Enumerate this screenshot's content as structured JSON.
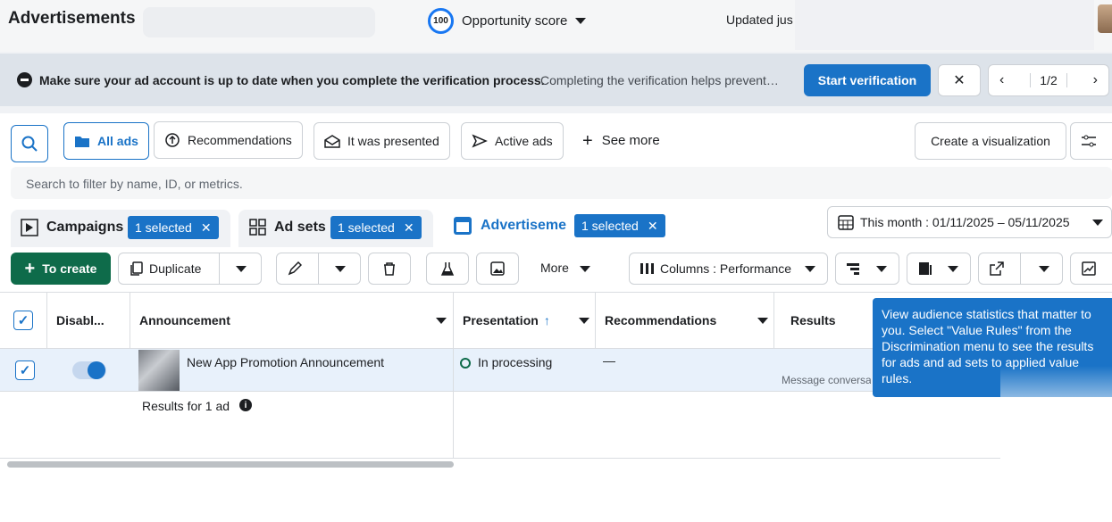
{
  "header": {
    "title": "Advertisements",
    "score_value": "100",
    "score_label": "Opportunity score",
    "updated": "Updated jus"
  },
  "banner": {
    "bold_text": "Make sure your ad account is up to date when you complete the verification process.",
    "text": "Completing the verification helps prevent…",
    "button": "Start verification",
    "pager": "1/2"
  },
  "filters": {
    "all_ads": "All ads",
    "recommendations": "Recommendations",
    "presented": "It was presented",
    "active": "Active ads",
    "see_more": "See more",
    "create_viz": "Create a visualization",
    "search_placeholder": "Search to filter by name, ID, or metrics."
  },
  "tabs": [
    {
      "label": "Campaigns",
      "badge": "1 selected"
    },
    {
      "label": "Ad sets",
      "badge": "1 selected"
    },
    {
      "label": "Advertiseme",
      "badge": "1 selected"
    }
  ],
  "date_range": "This month : 01/11/2025 – 05/11/2025",
  "toolbar": {
    "create": "To create",
    "duplicate": "Duplicate",
    "more": "More",
    "columns": "Columns : Performance"
  },
  "table": {
    "headers": [
      "Disabl...",
      "Announcement",
      "Presentation",
      "Recommendations",
      "Results"
    ],
    "row": {
      "name": "New App Promotion Announcement",
      "status": "In processing",
      "recommendation": "—",
      "results_sub": "Message conversa"
    },
    "summary": "Results for 1 ad"
  },
  "tooltip": "View audience statistics that matter to you. Select \"Value Rules\" from the Discrimination menu to see the results for ads and ad sets to applied value rules.",
  "colors": {
    "primary": "#1a73c7",
    "create": "#0e6b4a",
    "banner": "#dde3ea"
  }
}
